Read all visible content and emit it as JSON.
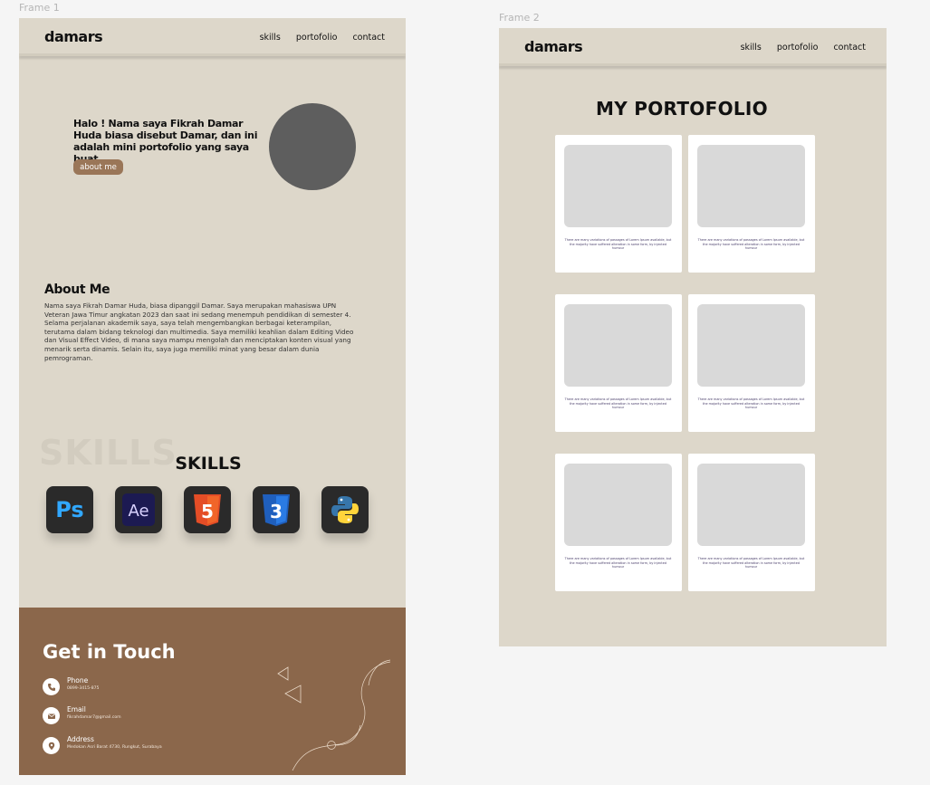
{
  "canvas": {
    "frame1_label": "Frame 1",
    "frame2_label": "Frame 2"
  },
  "frame1": {
    "nav": {
      "brand": "damars",
      "links": [
        "skills",
        "portofolio",
        "contact"
      ]
    },
    "hero": {
      "text": "Halo ! Nama saya Fikrah Damar Huda biasa disebut Damar, dan ini adalah mini portofolio yang saya buat",
      "button_label": "about me"
    },
    "about": {
      "title": "About Me",
      "body": "Nama saya Fikrah Damar Huda, biasa dipanggil Damar. Saya merupakan mahasiswa UPN Veteran Jawa Timur angkatan 2023 dan saat ini sedang menempuh pendidikan di semester 4. Selama perjalanan akademik saya, saya telah mengembangkan berbagai keterampilan, terutama dalam bidang teknologi dan multimedia. Saya memiliki keahlian dalam Editing Video dan Visual Effect Video, di mana saya mampu mengolah dan menciptakan konten visual yang menarik serta dinamis. Selain itu, saya juga memiliki minat yang besar dalam dunia pemrograman."
    },
    "skills": {
      "ghost": "SKILLS",
      "title": "SKILLS",
      "items": [
        {
          "icon": "photoshop-icon",
          "text": "Ps",
          "color": "#31a8ff",
          "bg": "#2b2b2b"
        },
        {
          "icon": "after-effects-icon",
          "text": "Ae",
          "color": "#d9d2ff",
          "bg": "#1c1a52"
        },
        {
          "icon": "html5-icon",
          "text": "5",
          "color": "#e44d26",
          "bg": "#2b2b2b"
        },
        {
          "icon": "css3-icon",
          "text": "3",
          "color": "#2a6fd6",
          "bg": "#2b2b2b"
        },
        {
          "icon": "python-icon",
          "text": "",
          "color": "#3776ab",
          "bg": "#2b2b2b"
        }
      ]
    },
    "footer": {
      "title": "Get in Touch",
      "contacts": [
        {
          "icon": "phone-icon",
          "label": "Phone",
          "value": "0899-3415-875"
        },
        {
          "icon": "email-icon",
          "label": "Email",
          "value": "fikrahdamar7@gmail.com"
        },
        {
          "icon": "location-icon",
          "label": "Address",
          "value": "Medokan Asri Barat 4730, Rungkut, Surabaya"
        }
      ]
    }
  },
  "frame2": {
    "nav": {
      "brand": "damars",
      "links": [
        "skills",
        "portofolio",
        "contact"
      ]
    },
    "title": "MY PORTOFOLIO",
    "cards": [
      {
        "text": "There are many variations of passages of Lorem Ipsum available, but the majority have suffered alteration in some form, by injected humour"
      },
      {
        "text": "There are many variations of passages of Lorem Ipsum available, but the majority have suffered alteration in some form, by injected humour"
      },
      {
        "text": "There are many variations of passages of Lorem Ipsum available, but the majority have suffered alteration in some form, by injected humour"
      },
      {
        "text": "There are many variations of passages of Lorem Ipsum available, but the majority have suffered alteration in some form, by injected humour"
      },
      {
        "text": "There are many variations of passages of Lorem Ipsum available, but the majority have suffered alteration in some form, by injected humour"
      },
      {
        "text": "There are many variations of passages of Lorem Ipsum available, but the majority have suffered alteration in some form, by injected humour"
      }
    ]
  },
  "colors": {
    "frame_bg": "#ddd7ca",
    "accent_button": "#9a7658",
    "footer_bg": "#8b674b",
    "card_bg": "#ffffff",
    "placeholder": "#d9d9d9"
  }
}
